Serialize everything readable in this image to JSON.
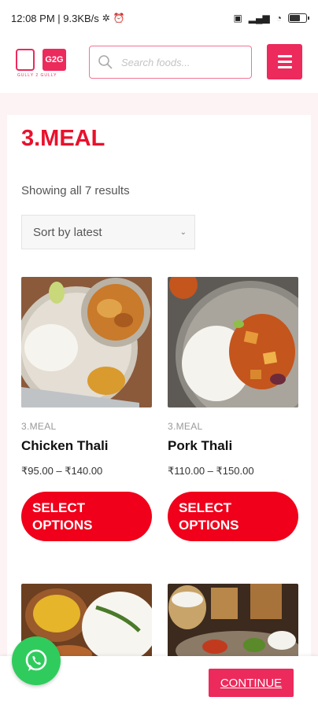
{
  "status_bar": {
    "time_speed": "12:08 PM | 9.3KB/s"
  },
  "header": {
    "logo_badge": "G2G",
    "logo_tagline": "GULLY 2 GULLY",
    "search_placeholder": "Search foods..."
  },
  "page": {
    "title": "3.MEAL",
    "results_text": "Showing all 7 results",
    "sort_value": "Sort by latest"
  },
  "products": [
    {
      "category": "3.MEAL",
      "name": "Chicken Thali",
      "price": "₹95.00 – ₹140.00",
      "button": "SELECT OPTIONS"
    },
    {
      "category": "3.MEAL",
      "name": "Pork Thali",
      "price": "₹110.00 – ₹150.00",
      "button": "SELECT OPTIONS"
    }
  ],
  "footer": {
    "continue_label": "CONTINUE"
  },
  "colors": {
    "brand": "#ec2a5c",
    "title_red": "#e8112d",
    "button_red": "#f0001a",
    "whatsapp": "#2fcc5d"
  }
}
